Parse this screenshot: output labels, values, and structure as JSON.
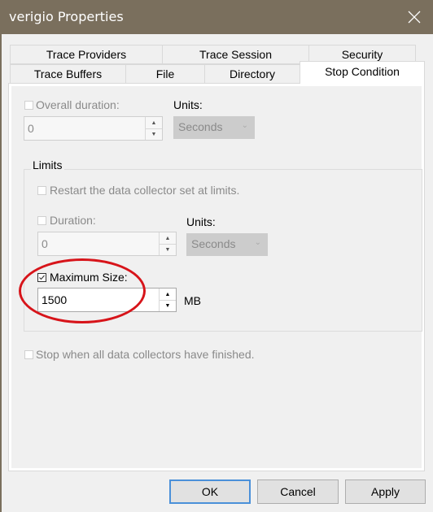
{
  "window": {
    "title": "verigio Properties",
    "close_icon": "close-icon"
  },
  "tabs": {
    "row_back": [
      {
        "label": "Trace Providers"
      },
      {
        "label": "Trace Session"
      },
      {
        "label": "Security"
      }
    ],
    "row_front": [
      {
        "label": "Trace Buffers"
      },
      {
        "label": "File"
      },
      {
        "label": "Directory"
      },
      {
        "label": "Stop Condition",
        "active": true
      }
    ]
  },
  "stop_condition": {
    "overall_duration": {
      "label": "Overall duration:",
      "checked": false,
      "enabled": false,
      "value": "0"
    },
    "overall_units": {
      "label": "Units:",
      "value": "Seconds",
      "enabled": false
    },
    "limits": {
      "title": "Limits",
      "restart": {
        "label": "Restart the data collector set at limits.",
        "checked": false,
        "enabled": false
      },
      "duration": {
        "label": "Duration:",
        "checked": false,
        "enabled": false,
        "value": "0"
      },
      "duration_units": {
        "label": "Units:",
        "value": "Seconds",
        "enabled": false
      },
      "max_size": {
        "label": "Maximum Size:",
        "checked": true,
        "enabled": true,
        "value": "1500",
        "unit": "MB"
      }
    },
    "stop_when_finished": {
      "label": "Stop when all data collectors have finished.",
      "checked": false,
      "enabled": false
    }
  },
  "annotation": {
    "type": "red-ellipse",
    "color": "#d7141a",
    "target": "Maximum Size"
  },
  "buttons": {
    "ok": "OK",
    "cancel": "Cancel",
    "apply": "Apply"
  }
}
